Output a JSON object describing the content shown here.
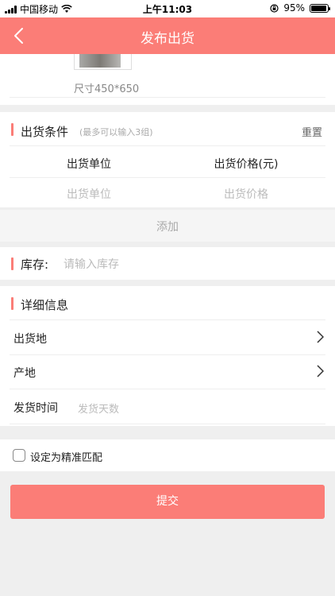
{
  "status_bar": {
    "carrier": "中国移动",
    "time": "上午11:03",
    "battery_percent": "95%",
    "battery_level": 0.95
  },
  "nav": {
    "title": "发布出货",
    "back_icon": "chevron-left-icon"
  },
  "image_section": {
    "size_hint": "尺寸450*650"
  },
  "conditions": {
    "title": "出货条件",
    "hint": "(最多可以输入3组)",
    "reset_label": "重置",
    "columns": [
      "出货单位",
      "出货价格(元)"
    ],
    "unit_placeholder": "出货单位",
    "price_placeholder": "出货价格",
    "add_label": "添加"
  },
  "stock": {
    "label": "库存:",
    "placeholder": "请输入库存"
  },
  "details": {
    "title": "详细信息",
    "rows": [
      {
        "label": "出货地"
      },
      {
        "label": "产地"
      },
      {
        "label": "发货时间",
        "placeholder": "发货天数"
      }
    ]
  },
  "precise_match": {
    "label": "设定为精准匹配",
    "checked": false
  },
  "submit_label": "提交",
  "colors": {
    "accent": "#fb7d77",
    "background": "#efefef"
  }
}
